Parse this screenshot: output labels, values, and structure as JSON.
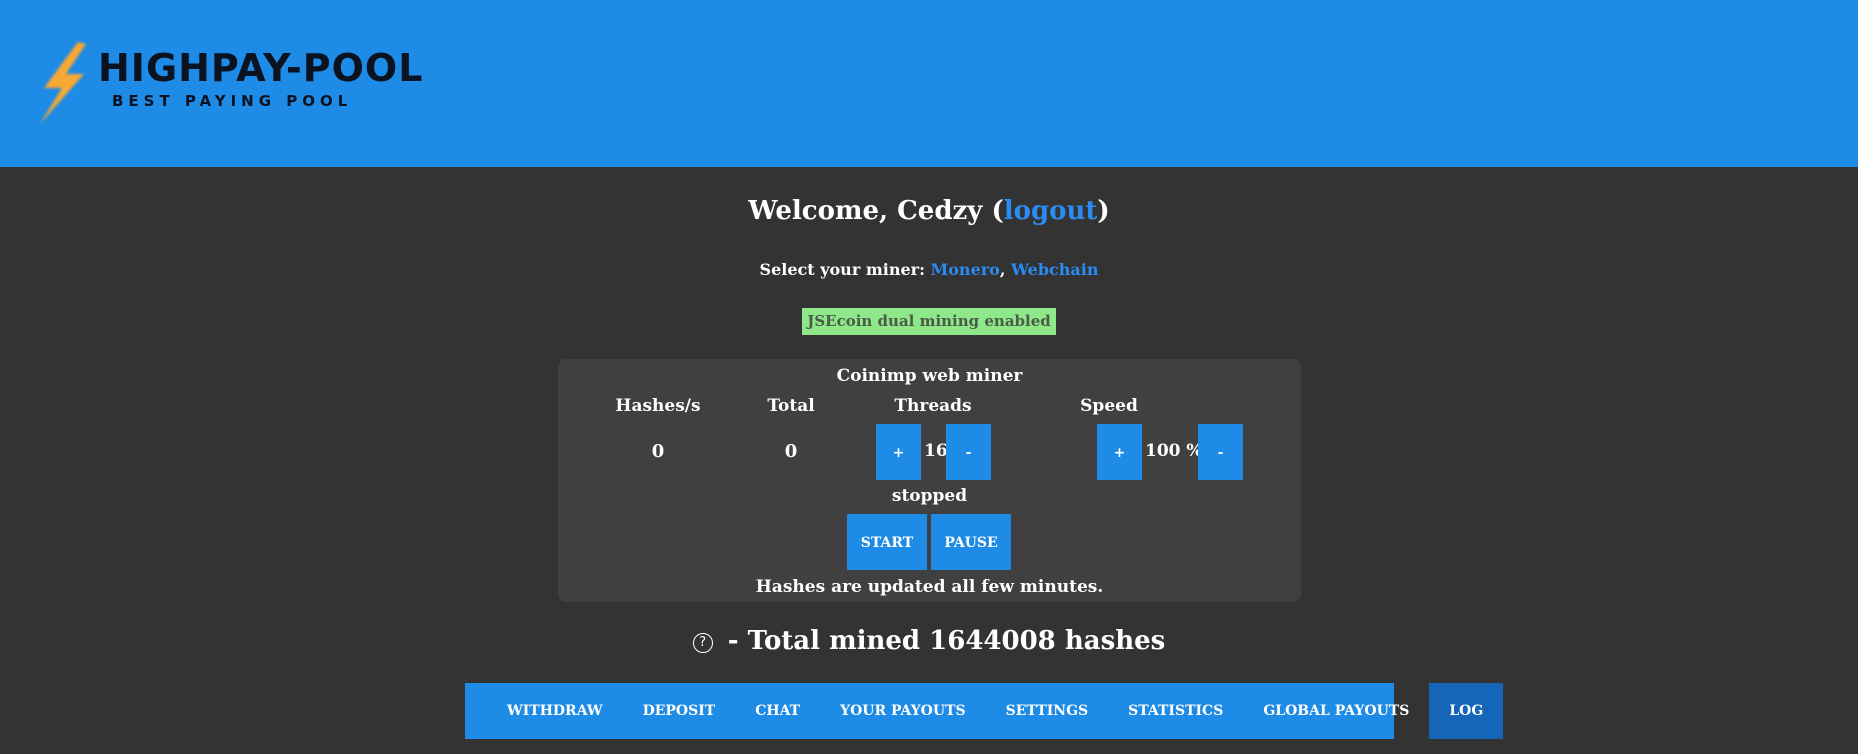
{
  "header": {
    "logo_title": "HIGHPAY-POOL",
    "logo_tagline": "BEST PAYING POOL",
    "background_color": "#1e8be6",
    "logo_icon": "lightning-bolt-icon"
  },
  "welcome": {
    "prefix": "Welcome, Cedzy (",
    "logout_label": "logout",
    "suffix": ")"
  },
  "miner_select": {
    "label": "Select your miner: ",
    "option_monero": "Monero",
    "separator": ", ",
    "option_webchain": "Webchain"
  },
  "dual_mining_badge": "JSEcoin dual mining enabled",
  "miner_panel": {
    "title": "Coinimp web miner",
    "hashes_label": "Hashes/s",
    "hashes_value": "0",
    "total_label": "Total",
    "total_value": "0",
    "threads_label": "Threads",
    "threads_plus": "+",
    "threads_value": "16",
    "threads_minus": "-",
    "speed_label": "Speed",
    "speed_plus": "+",
    "speed_value": "100 %",
    "speed_minus": "-",
    "status": "stopped",
    "start_label": "START",
    "pause_label": "PAUSE",
    "note": "Hashes are updated all few minutes."
  },
  "total_mined": {
    "help_icon": "?",
    "text": " - Total mined 1644008 hashes"
  },
  "nav": {
    "items": [
      {
        "label": "WITHDRAW"
      },
      {
        "label": "DEPOSIT"
      },
      {
        "label": "CHAT"
      },
      {
        "label": "YOUR PAYOUTS"
      },
      {
        "label": "SETTINGS"
      },
      {
        "label": "STATISTICS"
      },
      {
        "label": "GLOBAL PAYOUTS"
      },
      {
        "label": "LOG",
        "active": true
      }
    ]
  },
  "colors": {
    "accent": "#1e8be6",
    "link": "#2a8bf2",
    "page_bg": "#333333",
    "panel_bg": "#404040",
    "badge_bg": "#8ee88a"
  }
}
